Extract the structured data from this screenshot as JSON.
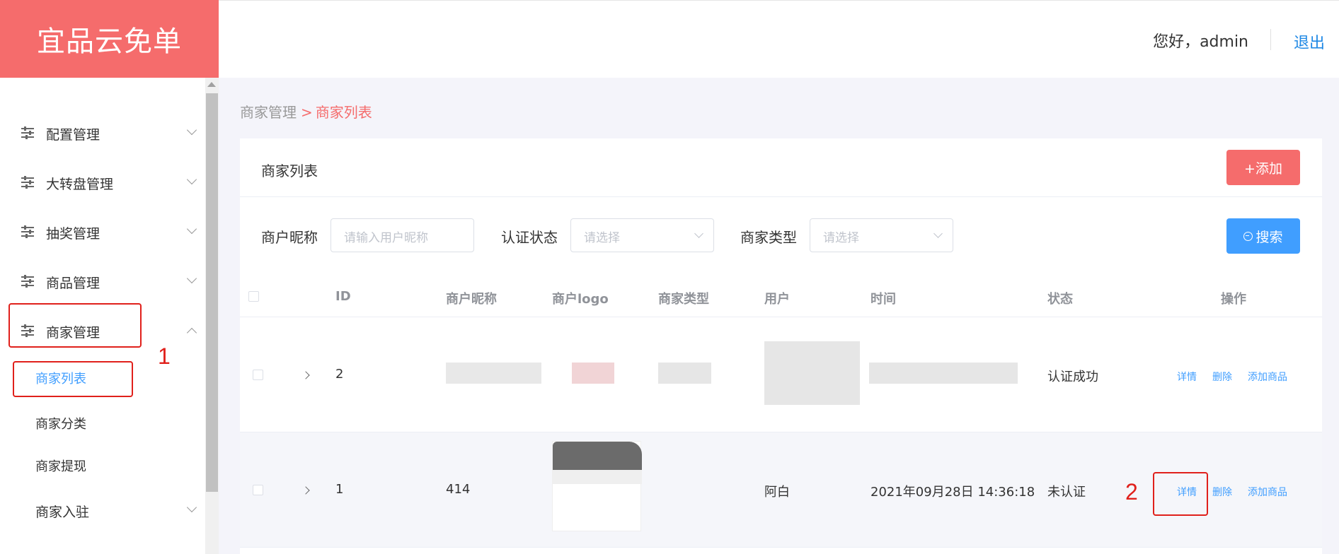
{
  "app": {
    "title": "宜品云免单"
  },
  "header": {
    "greeting": "您好，admin",
    "logout_label": "退出"
  },
  "sidebar": {
    "items": [
      {
        "label": "配置管理"
      },
      {
        "label": "大转盘管理"
      },
      {
        "label": "抽奖管理"
      },
      {
        "label": "商品管理"
      },
      {
        "label": "商家管理",
        "expanded": true
      },
      {
        "label": "商家入驻"
      }
    ],
    "subitems": [
      {
        "label": "商家列表",
        "active": true
      },
      {
        "label": "商家分类"
      },
      {
        "label": "商家提现"
      }
    ]
  },
  "breadcrumb": {
    "parent": "商家管理",
    "separator": ">",
    "current": "商家列表"
  },
  "card": {
    "title": "商家列表",
    "add_label": "+添加"
  },
  "filters": {
    "nickname_label": "商户昵称",
    "nickname_placeholder": "请输入用户昵称",
    "auth_label": "认证状态",
    "auth_placeholder": "请选择",
    "type_label": "商家类型",
    "type_placeholder": "请选择",
    "search_label": "搜索"
  },
  "table": {
    "columns": [
      "ID",
      "商户昵称",
      "商户logo",
      "商家类型",
      "用户",
      "时间",
      "状态",
      "操作"
    ],
    "rows": [
      {
        "id": "2",
        "nickname": "",
        "type": "",
        "user": "",
        "time": "",
        "status": "认证成功"
      },
      {
        "id": "1",
        "nickname": "414",
        "type": "",
        "user": "阿白",
        "time": "2021年09月28日 14:36:18",
        "status": "未认证"
      }
    ],
    "actions": {
      "detail": "详情",
      "delete": "删除",
      "add_goods": "添加商品"
    }
  },
  "annotations": {
    "marker1": "1",
    "marker2": "2"
  },
  "colors": {
    "brand": "#f56c6c",
    "primary": "#409eff",
    "annotation": "#e0201b"
  }
}
